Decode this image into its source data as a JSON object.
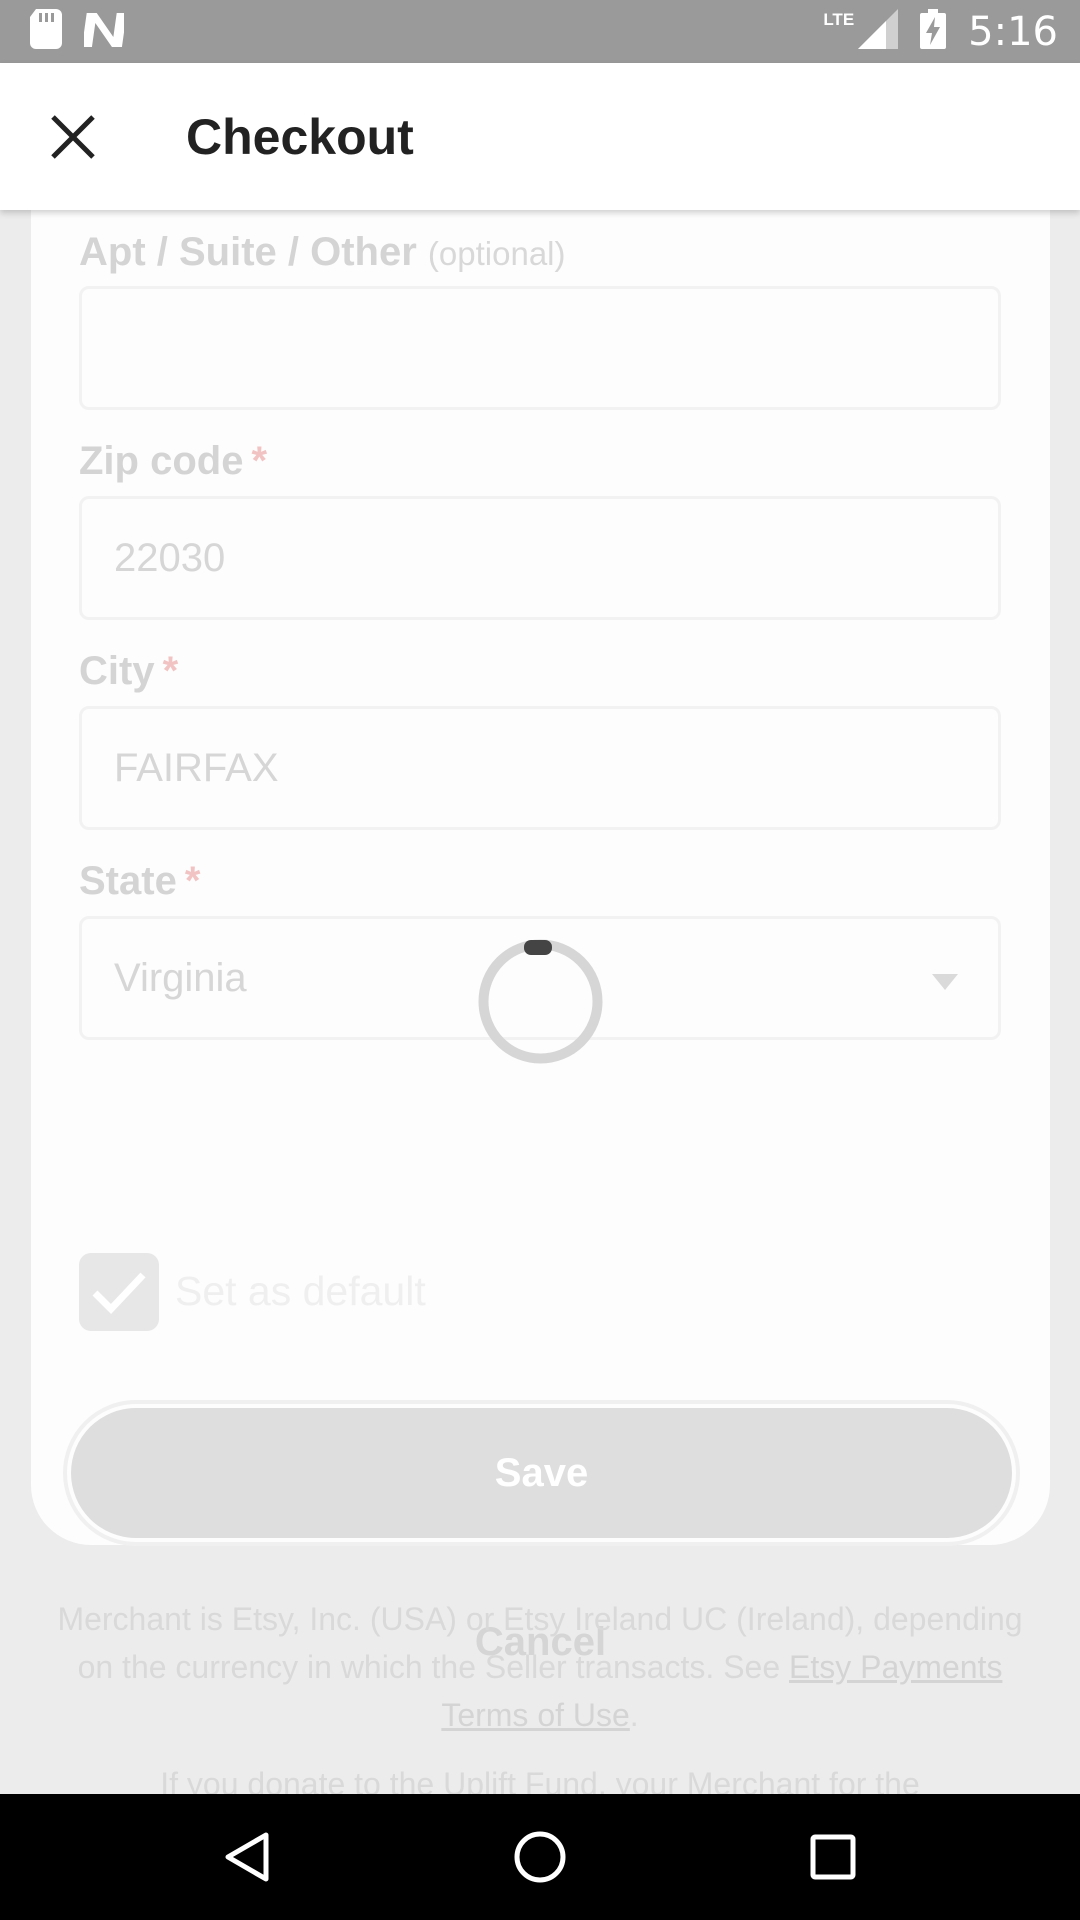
{
  "status_bar": {
    "network": "LTE",
    "time": "5:16"
  },
  "app_bar": {
    "title": "Checkout"
  },
  "form": {
    "apt": {
      "label": "Apt / Suite / Other",
      "optional": "(optional)",
      "value": ""
    },
    "zip": {
      "label": "Zip code",
      "required_mark": "*",
      "value": "22030"
    },
    "city": {
      "label": "City",
      "required_mark": "*",
      "value": "FAIRFAX"
    },
    "state": {
      "label": "State",
      "required_mark": "*",
      "value": "Virginia"
    },
    "default_checkbox": {
      "label": "Set as default",
      "checked": true
    },
    "save_label": "Save",
    "cancel_label": "Cancel"
  },
  "legal": {
    "text_before": "Merchant is Etsy, Inc. (USA) or Etsy Ireland UC (Ireland), depending on the currency in which the Seller transacts. See ",
    "link": "Etsy Payments Terms of Use",
    "text_after": ".",
    "partial_line": "If you donate to the Uplift Fund, your Merchant for the"
  },
  "colors": {
    "accent_scrim": "#eaeaea",
    "spinner": "#d6d6d6"
  }
}
